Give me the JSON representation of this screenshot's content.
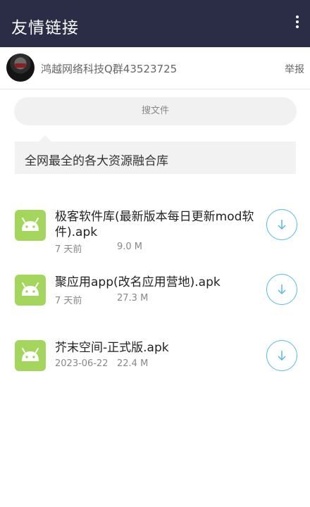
{
  "appbar": {
    "title": "友情链接",
    "menu_icon": "more-vert-icon"
  },
  "owner": {
    "name": "鸿越网络科技Q群43523725",
    "report_label": "举报"
  },
  "search": {
    "label": "搜文件"
  },
  "notice": {
    "text": "全网最全的各大资源融合库"
  },
  "files": [
    {
      "name": "极客软件库(最新版本每日更新mod软件).apk",
      "date": "7 天前",
      "size": "9.0 M"
    },
    {
      "name": "聚应用app(改名应用营地).apk",
      "date": "7 天前",
      "size": "27.3 M"
    },
    {
      "name": "芥末空间-正式版.apk",
      "date": "2023-06-22",
      "size": "22.4 M"
    }
  ],
  "colors": {
    "appbar": "#2b2c45",
    "android_icon": "#a4d65e",
    "download_accent": "#56b9e6"
  }
}
